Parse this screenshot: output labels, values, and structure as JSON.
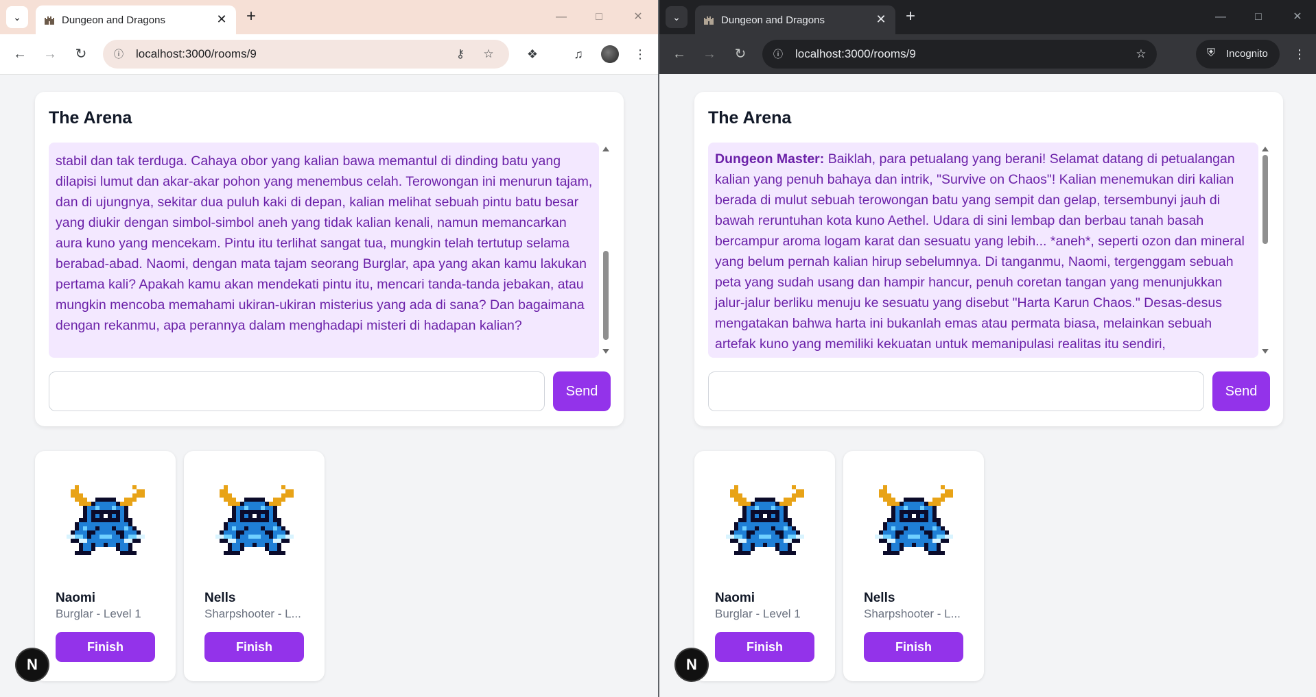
{
  "tab": {
    "title": "Dungeon and Dragons"
  },
  "address": {
    "url": "localhost:3000/rooms/9"
  },
  "incognito_label": "Incognito",
  "room": {
    "title": "The Arena",
    "send_label": "Send",
    "message_placeholder": ""
  },
  "chat_left": {
    "speaker": "",
    "text": "stabil dan tak terduga. Cahaya obor yang kalian bawa memantul di dinding batu yang dilapisi lumut dan akar-akar pohon yang menembus celah. Terowongan ini menurun tajam, dan di ujungnya, sekitar dua puluh kaki di depan, kalian melihat sebuah pintu batu besar yang diukir dengan simbol-simbol aneh yang tidak kalian kenali, namun memancarkan aura kuno yang mencekam. Pintu itu terlihat sangat tua, mungkin telah tertutup selama berabad-abad. Naomi, dengan mata tajam seorang Burglar, apa yang akan kamu lakukan pertama kali? Apakah kamu akan mendekati pintu itu, mencari tanda-tanda jebakan, atau mungkin mencoba memahami ukiran-ukiran misterius yang ada di sana? Dan bagaimana dengan rekanmu, apa perannya dalam menghadapi misteri di hadapan kalian?"
  },
  "chat_right": {
    "speaker": "Dungeon Master:",
    "text": "Baiklah, para petualang yang berani! Selamat datang di petualangan kalian yang penuh bahaya dan intrik, \"Survive on Chaos\"! Kalian menemukan diri kalian berada di mulut sebuah terowongan batu yang sempit dan gelap, tersembunyi jauh di bawah reruntuhan kota kuno Aethel. Udara di sini lembap dan berbau tanah basah bercampur aroma logam karat dan sesuatu yang lebih... *aneh*, seperti ozon dan mineral yang belum pernah kalian hirup sebelumnya. Di tanganmu, Naomi, tergenggam sebuah peta yang sudah usang dan hampir hancur, penuh coretan tangan yang menunjukkan jalur-jalur berliku menuju ke sesuatu yang disebut \"Harta Karun Chaos.\" Desas-desus mengatakan bahwa harta ini bukanlah emas atau permata biasa, melainkan sebuah artefak kuno yang memiliki kekuatan untuk memanipulasi realitas itu sendiri,"
  },
  "players": [
    {
      "name": "Naomi",
      "class": "Burglar - Level 1",
      "finish_label": "Finish",
      "sprite": "shovel-knight-sprite"
    },
    {
      "name": "Nells",
      "class": "Sharpshooter - L...",
      "finish_label": "Finish",
      "sprite": "shovel-knight-sprite"
    }
  ],
  "dev_badge": "N",
  "icons": {
    "tab_search": "chevron-down-icon",
    "back": "arrow-left-icon",
    "forward": "arrow-right-icon",
    "reload": "reload-icon",
    "site_info": "info-icon",
    "password": "key-icon",
    "bookmark": "star-icon",
    "extensions": "puzzle-icon",
    "media": "media-control-icon",
    "menu": "kebab-menu-icon"
  },
  "colors": {
    "accent": "#9333ea",
    "chat_bg": "#f3e8ff",
    "chat_text": "#6b21a8",
    "page_bg": "#f3f4f6"
  }
}
